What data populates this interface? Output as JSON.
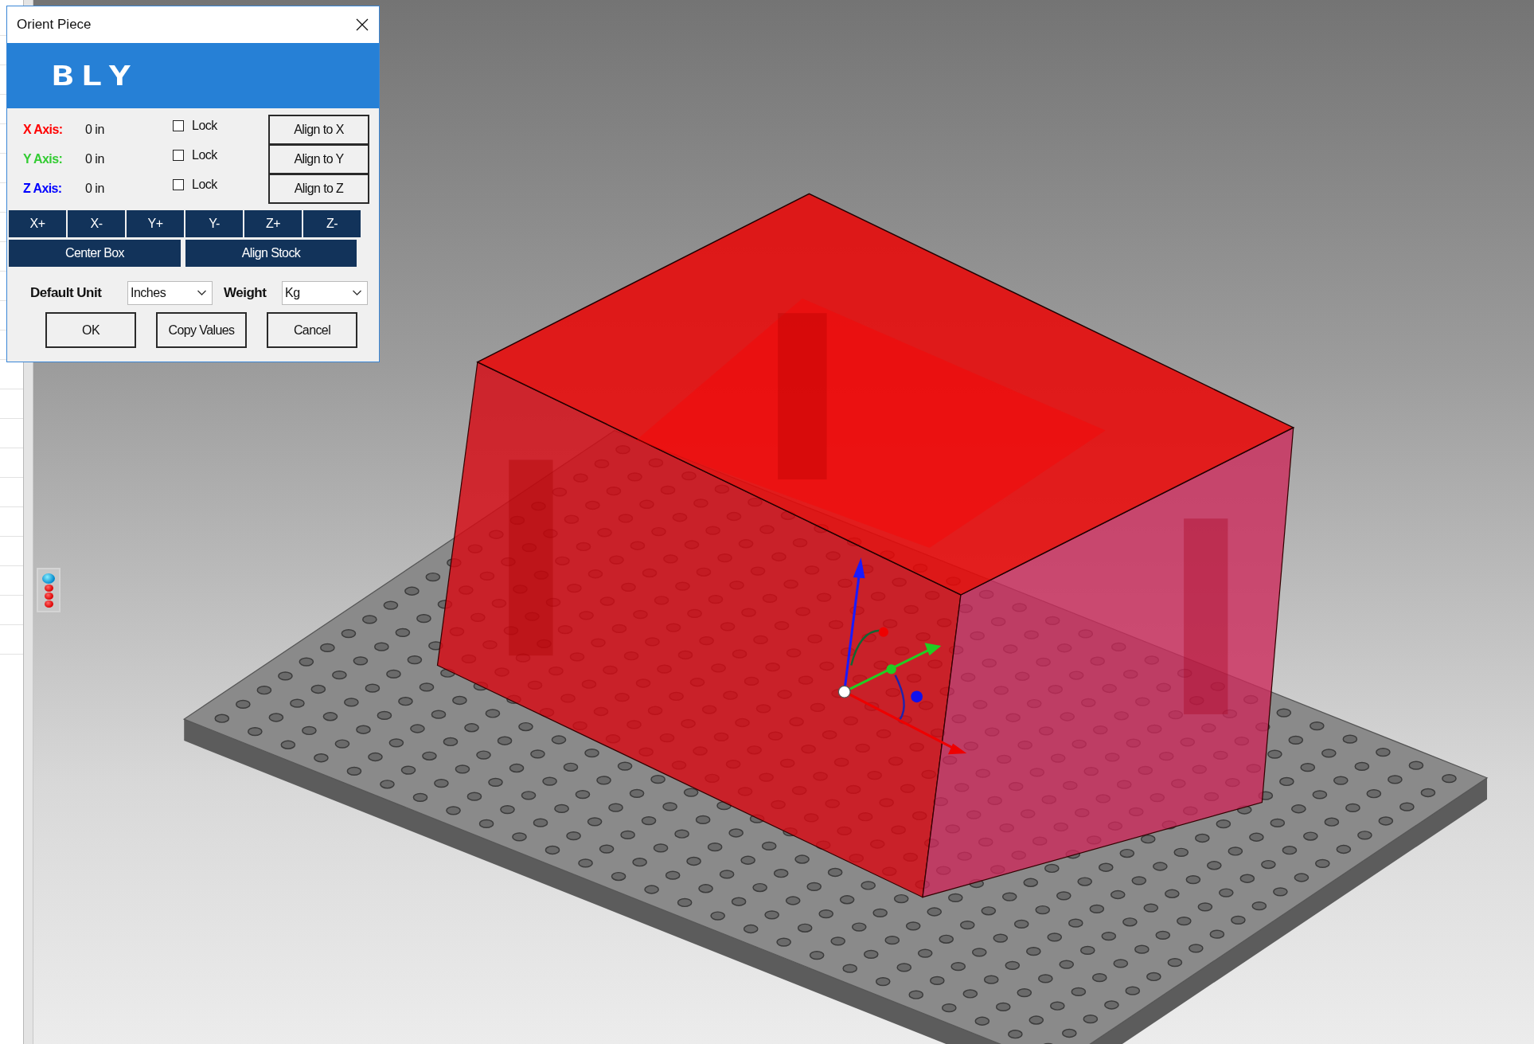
{
  "window": {
    "title": "Orient Piece"
  },
  "logo": "BLY",
  "axes": [
    {
      "label": "X Axis:",
      "color": "#ff0000",
      "value": "0 in",
      "lock_label": "Lock",
      "checked": false,
      "align_button": "Align to X"
    },
    {
      "label": "Y Axis:",
      "color": "#33cc33",
      "value": "0 in",
      "lock_label": "Lock",
      "checked": false,
      "align_button": "Align to Y"
    },
    {
      "label": "Z Axis:",
      "color": "#0000ff",
      "value": "0 in",
      "lock_label": "Lock",
      "checked": false,
      "align_button": "Align to Z"
    }
  ],
  "direction_buttons": [
    "X+",
    "X-",
    "Y+",
    "Y-",
    "Z+",
    "Z-"
  ],
  "action_buttons": [
    "Center Box",
    "Align Stock"
  ],
  "default_unit": {
    "label": "Default Unit",
    "value": "Inches"
  },
  "weight": {
    "label": "Weight",
    "value": "Kg"
  },
  "buttons": [
    "OK",
    "Copy Values",
    "Cancel"
  ]
}
